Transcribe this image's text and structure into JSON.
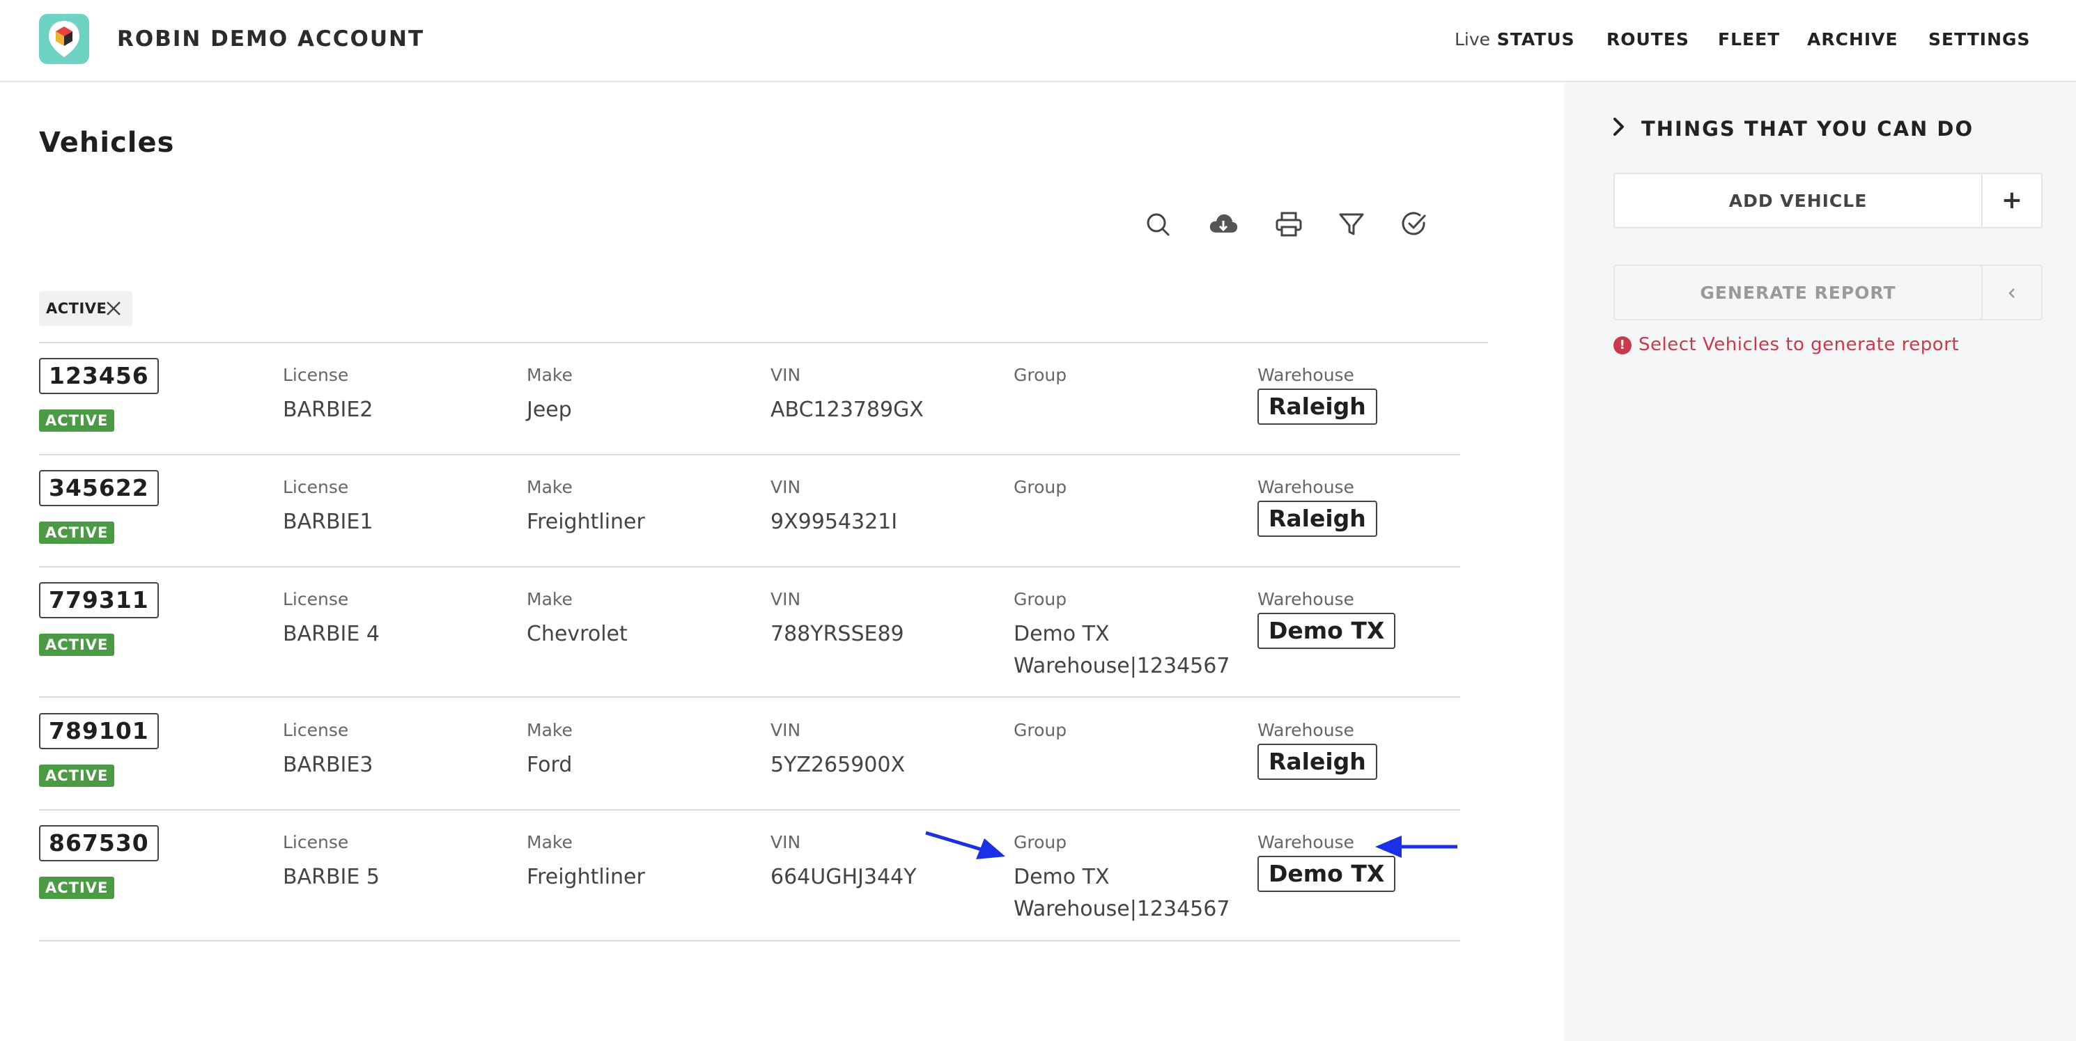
{
  "header": {
    "account_name": "ROBIN DEMO ACCOUNT",
    "nav": {
      "live_prefix": "Live",
      "status": "STATUS",
      "routes": "ROUTES",
      "fleet": "FLEET",
      "archive": "ARCHIVE",
      "settings": "SETTINGS"
    }
  },
  "page": {
    "title": "Vehicles",
    "toolbar_icons": [
      "search-icon",
      "cloud-download-icon",
      "printer-icon",
      "filter-icon",
      "check-circle-icon"
    ],
    "active_filter": "ACTIVE"
  },
  "labels": {
    "license": "License",
    "make": "Make",
    "vin": "VIN",
    "group": "Group",
    "warehouse": "Warehouse"
  },
  "vehicles": [
    {
      "id": "123456",
      "status": "ACTIVE",
      "license": "BARBIE2",
      "make": "Jeep",
      "vin": "ABC123789GX",
      "group": "",
      "warehouse": "Raleigh"
    },
    {
      "id": "345622",
      "status": "ACTIVE",
      "license": "BARBIE1",
      "make": "Freightliner",
      "vin": "9X9954321I",
      "group": "",
      "warehouse": "Raleigh"
    },
    {
      "id": "779311",
      "status": "ACTIVE",
      "license": "BARBIE 4",
      "make": "Chevrolet",
      "vin": "788YRSSE89",
      "group": "Demo TX Warehouse|1234567",
      "warehouse": "Demo TX"
    },
    {
      "id": "789101",
      "status": "ACTIVE",
      "license": "BARBIE3",
      "make": "Ford",
      "vin": "5YZ265900X",
      "group": "",
      "warehouse": "Raleigh"
    },
    {
      "id": "867530",
      "status": "ACTIVE",
      "license": "BARBIE 5",
      "make": "Freightliner",
      "vin": "664UGHJ344Y",
      "group": "Demo TX Warehouse|1234567",
      "warehouse": "Demo TX"
    }
  ],
  "side_panel": {
    "header": "THINGS THAT YOU CAN DO",
    "add_vehicle": "ADD VEHICLE",
    "add_icon": "+",
    "generate_report": "GENERATE REPORT",
    "warning": "Select Vehicles to generate report"
  },
  "colors": {
    "active_badge": "#4a9b44",
    "warning": "#c9394a",
    "annotation_arrow": "#1a2fe6",
    "logo_bg": "#6fd3c4"
  }
}
